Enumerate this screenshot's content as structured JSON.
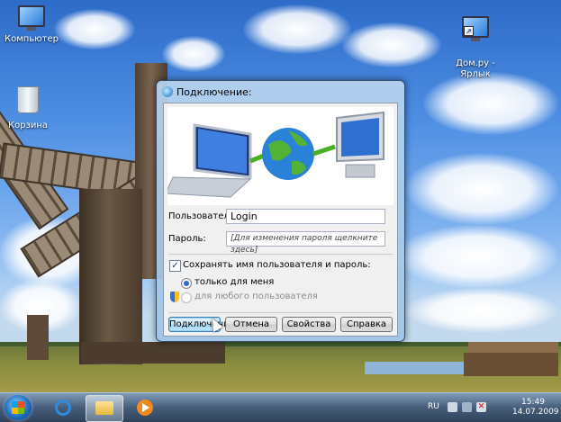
{
  "desktop": {
    "icons": [
      {
        "label": "Компьютер",
        "icon": "computer-icon"
      },
      {
        "label": "Корзина",
        "icon": "recycle-bin-icon"
      },
      {
        "label": "Дом.ру -\nЯрлык",
        "icon": "network-shortcut-icon"
      }
    ]
  },
  "dialog": {
    "title": "Подключение:",
    "user_label": "Пользователь:",
    "user_value": "Login",
    "password_label": "Пароль:",
    "password_hint": "[Для изменения пароля щелкните здесь]",
    "save_label": "Сохранять имя пользователя и пароль:",
    "save_checked": true,
    "option_me": "только для меня",
    "option_any": "для любого пользователя",
    "buttons": {
      "connect": "Подключение",
      "cancel": "Отмена",
      "properties": "Свойства",
      "help": "Справка"
    }
  },
  "taskbar": {
    "lang": "RU",
    "time": "15:49",
    "date": "14.07.2009",
    "pinned": [
      "internet-explorer-icon",
      "explorer-folder-icon",
      "media-player-icon"
    ]
  }
}
